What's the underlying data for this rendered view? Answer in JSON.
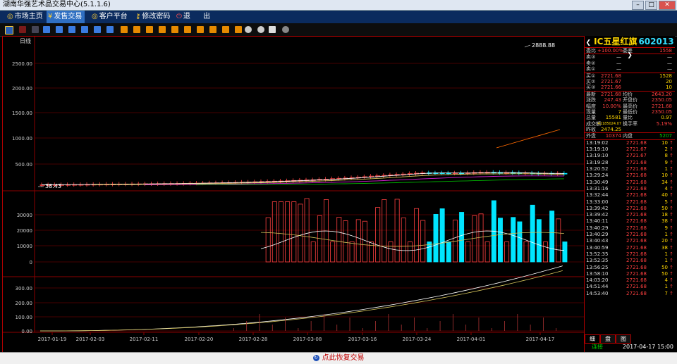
{
  "window": {
    "title": "湖南华强艺术品交易中心(5.1.1.6)",
    "controls": [
      "minimize-icon",
      "maximize-icon",
      "close-icon"
    ]
  },
  "menu": {
    "items": [
      {
        "label": "市场主页",
        "icon": "home-icon"
      },
      {
        "label": "发售交易",
        "icon": "trade-icon"
      },
      {
        "label": "客户平台",
        "icon": "client-icon"
      },
      {
        "label": "修改密码",
        "icon": "key-icon"
      },
      {
        "label": "退",
        "icon": "exit-icon"
      },
      {
        "label": "出",
        "icon": ""
      }
    ],
    "active_index": 1
  },
  "chart": {
    "period_label": "日线",
    "high_label": "2888.88",
    "low_label": "38.43",
    "price_ticks": [
      "2500.00",
      "2000.00",
      "1500.00",
      "1000.00",
      "500.00"
    ],
    "volume_ticks": [
      "30000",
      "20000",
      "10000",
      "0"
    ],
    "indicator_ticks": [
      "300.00",
      "200.00",
      "100.00",
      "0.00"
    ],
    "date_ticks": [
      "2017-01-19",
      "2017-02-03",
      "2017-02-11",
      "2017-02-20",
      "2017-02-28",
      "2017-03-08",
      "2017-03-16",
      "2017-03-24",
      "2017-04-01",
      "2017-04-17"
    ]
  },
  "quote": {
    "name": "IC五星红旗",
    "code": "602013",
    "weibi_label": "委比",
    "weibi_value": "+100.00%",
    "weicha_label": "委差",
    "weicha_value": "1558",
    "sell": [
      {
        "label": "卖③",
        "price": "—",
        "vol": "—"
      },
      {
        "label": "卖②",
        "price": "—",
        "vol": "—"
      },
      {
        "label": "卖①",
        "price": "—",
        "vol": "—"
      }
    ],
    "buy": [
      {
        "label": "买①",
        "price": "2721.68",
        "vol": "1528"
      },
      {
        "label": "买②",
        "price": "2721.67",
        "vol": "20"
      },
      {
        "label": "买③",
        "price": "2721.66",
        "vol": "10"
      }
    ],
    "stats": [
      {
        "l1": "最新",
        "v1": "2721.68",
        "l2": "均价",
        "v2": "2643.20"
      },
      {
        "l1": "涨跌",
        "v1": "247.43",
        "l2": "开盘价",
        "v2": "2350.05"
      },
      {
        "l1": "幅度",
        "v1": "10.00%",
        "l2": "最高价",
        "v2": "2721.68"
      },
      {
        "l1": "现量",
        "v1": "7",
        "l2": "最低价",
        "v2": "2350.05"
      },
      {
        "l1": "总量",
        "v1": "15581",
        "l2": "量比",
        "v2": "0.97"
      },
      {
        "l1": "成交额",
        "v1": "41185024.07",
        "l2": "换手率",
        "v2": "5.19%"
      },
      {
        "l1": "昨收",
        "v1": "2474.25",
        "l2": "",
        "v2": ""
      }
    ],
    "outer_label": "外盘",
    "outer_value": "10374",
    "inner_label": "内盘",
    "inner_value": "5207",
    "ticks": [
      [
        "13:19:02",
        "2721.68",
        "10"
      ],
      [
        "13:19:10",
        "2721.67",
        "2"
      ],
      [
        "13:19:10",
        "2721.67",
        "8"
      ],
      [
        "13:19:28",
        "2721.68",
        "9"
      ],
      [
        "13:20:52",
        "2721.68",
        "1"
      ],
      [
        "13:29:24",
        "2721.68",
        "10"
      ],
      [
        "13:30:49",
        "2721.68",
        "34"
      ],
      [
        "13:31:16",
        "2721.68",
        "4"
      ],
      [
        "13:32:44",
        "2721.68",
        "40"
      ],
      [
        "13:33:00",
        "2721.68",
        "5"
      ],
      [
        "13:39:42",
        "2721.68",
        "50"
      ],
      [
        "13:39:42",
        "2721.68",
        "18"
      ],
      [
        "13:40:11",
        "2721.68",
        "38"
      ],
      [
        "13:40:29",
        "2721.68",
        "9"
      ],
      [
        "13:40:29",
        "2721.68",
        "1"
      ],
      [
        "13:40:43",
        "2721.68",
        "20"
      ],
      [
        "13:40:59",
        "2721.68",
        "38"
      ],
      [
        "13:52:35",
        "2721.68",
        "1"
      ],
      [
        "13:52:35",
        "2721.68",
        "1"
      ],
      [
        "13:56:25",
        "2721.68",
        "50"
      ],
      [
        "13:58:10",
        "2721.68",
        "50"
      ],
      [
        "14:03:20",
        "2721.68",
        "4"
      ],
      [
        "14:51:44",
        "2721.68",
        "1"
      ],
      [
        "14:53:40",
        "2721.68",
        "7"
      ]
    ],
    "tabs": [
      "细",
      "盘",
      "图"
    ],
    "status_conn": "连接",
    "status_time": "2017-04-17 15:00"
  },
  "footer": {
    "resume_label": "点此恢复交易"
  },
  "colors": {
    "up": "#ff4040",
    "down": "#00e5ff",
    "ma5": "#ffffff",
    "ma10": "#d4c35a",
    "ma20": "#d020d0",
    "ma60": "#00b000",
    "ma120": "#ff6a00",
    "grid": "#8b0000"
  }
}
